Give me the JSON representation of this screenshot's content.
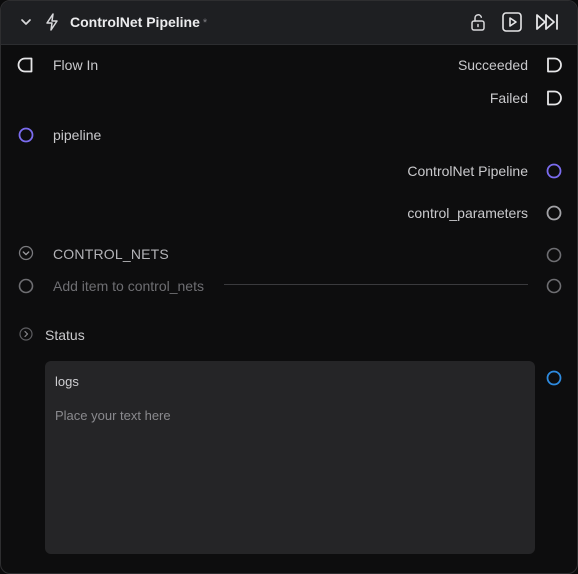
{
  "header": {
    "title": "ControlNet Pipeline",
    "modified_marker": "*",
    "icons": [
      "chevron-down-icon",
      "lightning-icon",
      "unlock-icon",
      "play-icon",
      "run-all-icon"
    ]
  },
  "ports": {
    "flow_in": "Flow In",
    "succeeded": "Succeeded",
    "failed": "Failed",
    "pipeline_input": "pipeline",
    "pipeline_output": "ControlNet Pipeline",
    "control_parameters": "control_parameters",
    "control_nets": "CONTROL_NETS",
    "add_item": "Add item to control_nets",
    "status": "Status"
  },
  "logs": {
    "label": "logs",
    "placeholder": "Place your text here"
  },
  "colors": {
    "pipeline_port": "#7b6cf0",
    "logs_port": "#2e8be0",
    "neutral_port": "#8c8c90",
    "flow_port": "#e6e6e8"
  }
}
